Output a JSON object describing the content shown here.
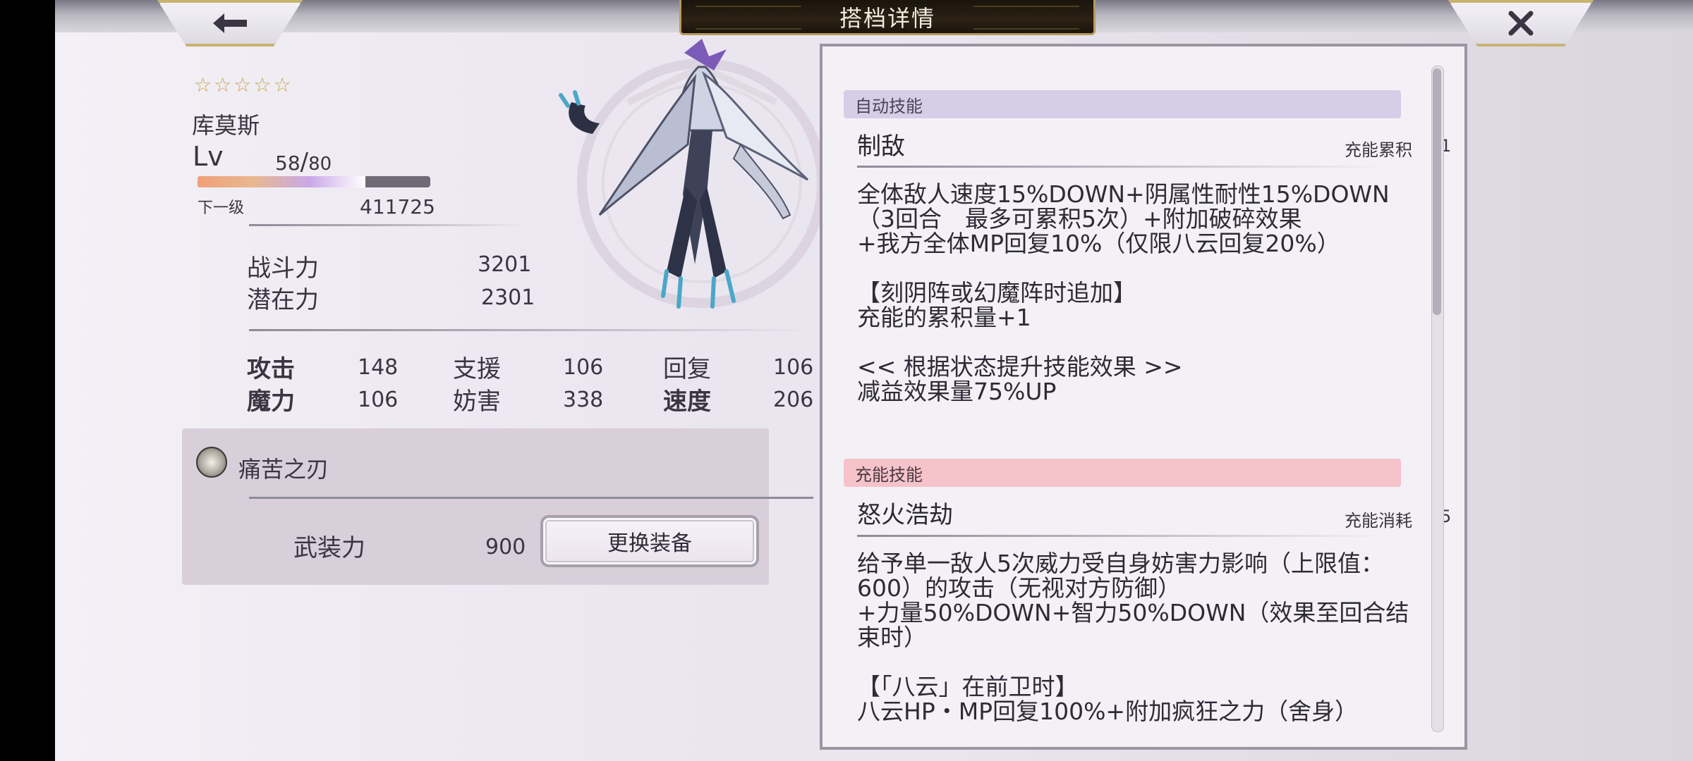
{
  "header": {
    "title": "搭档详情"
  },
  "character": {
    "stars": [
      "☆",
      "☆",
      "☆",
      "☆",
      "☆"
    ],
    "name": "库莫斯",
    "lv_label": "Lv",
    "level": "58",
    "level_sep": "/",
    "level_max": "80",
    "xp_fraction": 0.72,
    "next_label": "下一级",
    "next_value": "411725"
  },
  "power": [
    {
      "label": "战斗力",
      "value": "3201"
    },
    {
      "label": "潜在力",
      "value": "2301"
    }
  ],
  "stats": [
    {
      "label": "攻击",
      "value": "148"
    },
    {
      "label": "支援",
      "value": "106"
    },
    {
      "label": "回复",
      "value": "106"
    },
    {
      "label": "魔力",
      "value": "106"
    },
    {
      "label": "妨害",
      "value": "338"
    },
    {
      "label": "速度",
      "value": "206"
    }
  ],
  "equipment": {
    "name": "痛苦之刃",
    "armament_label": "武装力",
    "armament_value": "900",
    "swap_button": "更换装备"
  },
  "skills": {
    "auto": {
      "category": "自动技能",
      "name": "制敌",
      "meta_label": "充能累积",
      "meta_value": "1",
      "lines": [
        "全体敌人速度15%DOWN+阴属性耐性15%DOWN",
        "（3回合　最多可累积5次）+附加破碎效果",
        "+我方全体MP回复10%（仅限八云回复20%）",
        "",
        "【刻阴阵或幻魔阵时追加】",
        "充能的累积量+1",
        "",
        "<< 根据状态提升技能效果 >>",
        "减益效果量75%UP"
      ]
    },
    "charge": {
      "category": "充能技能",
      "name": "怒火浩劫",
      "meta_label": "充能消耗",
      "meta_value": "5",
      "lines": [
        "给予单一敌人5次威力受自身妨害力影响（上限值：",
        "600）的攻击（无视对方防御）",
        "+力量50%DOWN+智力50%DOWN（效果至回合结",
        "束时）",
        "",
        "【「八云」在前卫时】",
        "八云HP・MP回复100%+附加疯狂之力（舍身）"
      ]
    }
  },
  "colors": {
    "auto_header": "#d6cde6",
    "charge_header": "#f6c3cb",
    "gold": "#c9b371"
  }
}
